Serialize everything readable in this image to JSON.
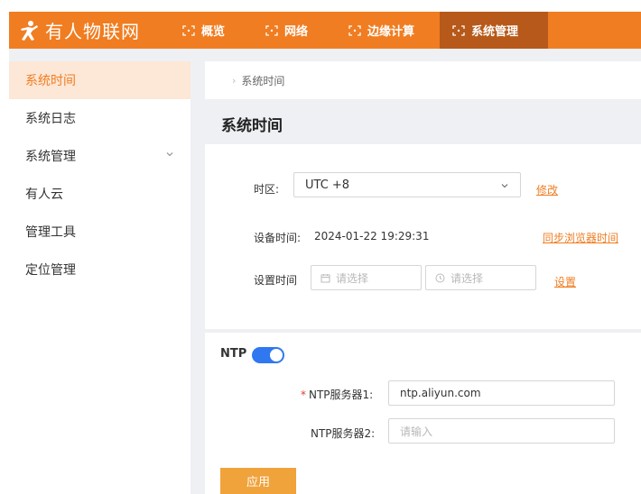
{
  "brand": {
    "name": "有人物联网"
  },
  "nav": [
    {
      "label": "概览",
      "active": false
    },
    {
      "label": "网络",
      "active": false
    },
    {
      "label": "边缘计算",
      "active": false
    },
    {
      "label": "系统管理",
      "active": true
    }
  ],
  "sidebar": {
    "items": [
      {
        "label": "系统时间",
        "active": true
      },
      {
        "label": "系统日志"
      },
      {
        "label": "系统管理",
        "expandable": true
      },
      {
        "label": "有人云"
      },
      {
        "label": "管理工具"
      },
      {
        "label": "定位管理"
      }
    ]
  },
  "breadcrumb": {
    "current": "系统时间"
  },
  "page": {
    "title": "系统时间"
  },
  "time_form": {
    "timezone_label": "时区:",
    "timezone_value": "UTC +8",
    "modify_link": "修改",
    "device_time_label": "设备时间:",
    "device_time_value": "2024-01-22 19:29:31",
    "sync_browser_link": "同步浏览器时间",
    "set_time_label": "设置时间",
    "date_placeholder": "请选择",
    "time_placeholder": "请选择",
    "set_link": "设置"
  },
  "ntp": {
    "label": "NTP",
    "enabled": true,
    "server1_label": "NTP服务器1:",
    "server1_value": "ntp.aliyun.com",
    "server2_label": "NTP服务器2:",
    "server2_placeholder": "请输入",
    "apply_button": "应用"
  },
  "colors": {
    "accent": "#f07d21",
    "active_nav": "#b6591a",
    "toggle_on": "#2f78f0",
    "apply_button": "#f0a23b"
  }
}
